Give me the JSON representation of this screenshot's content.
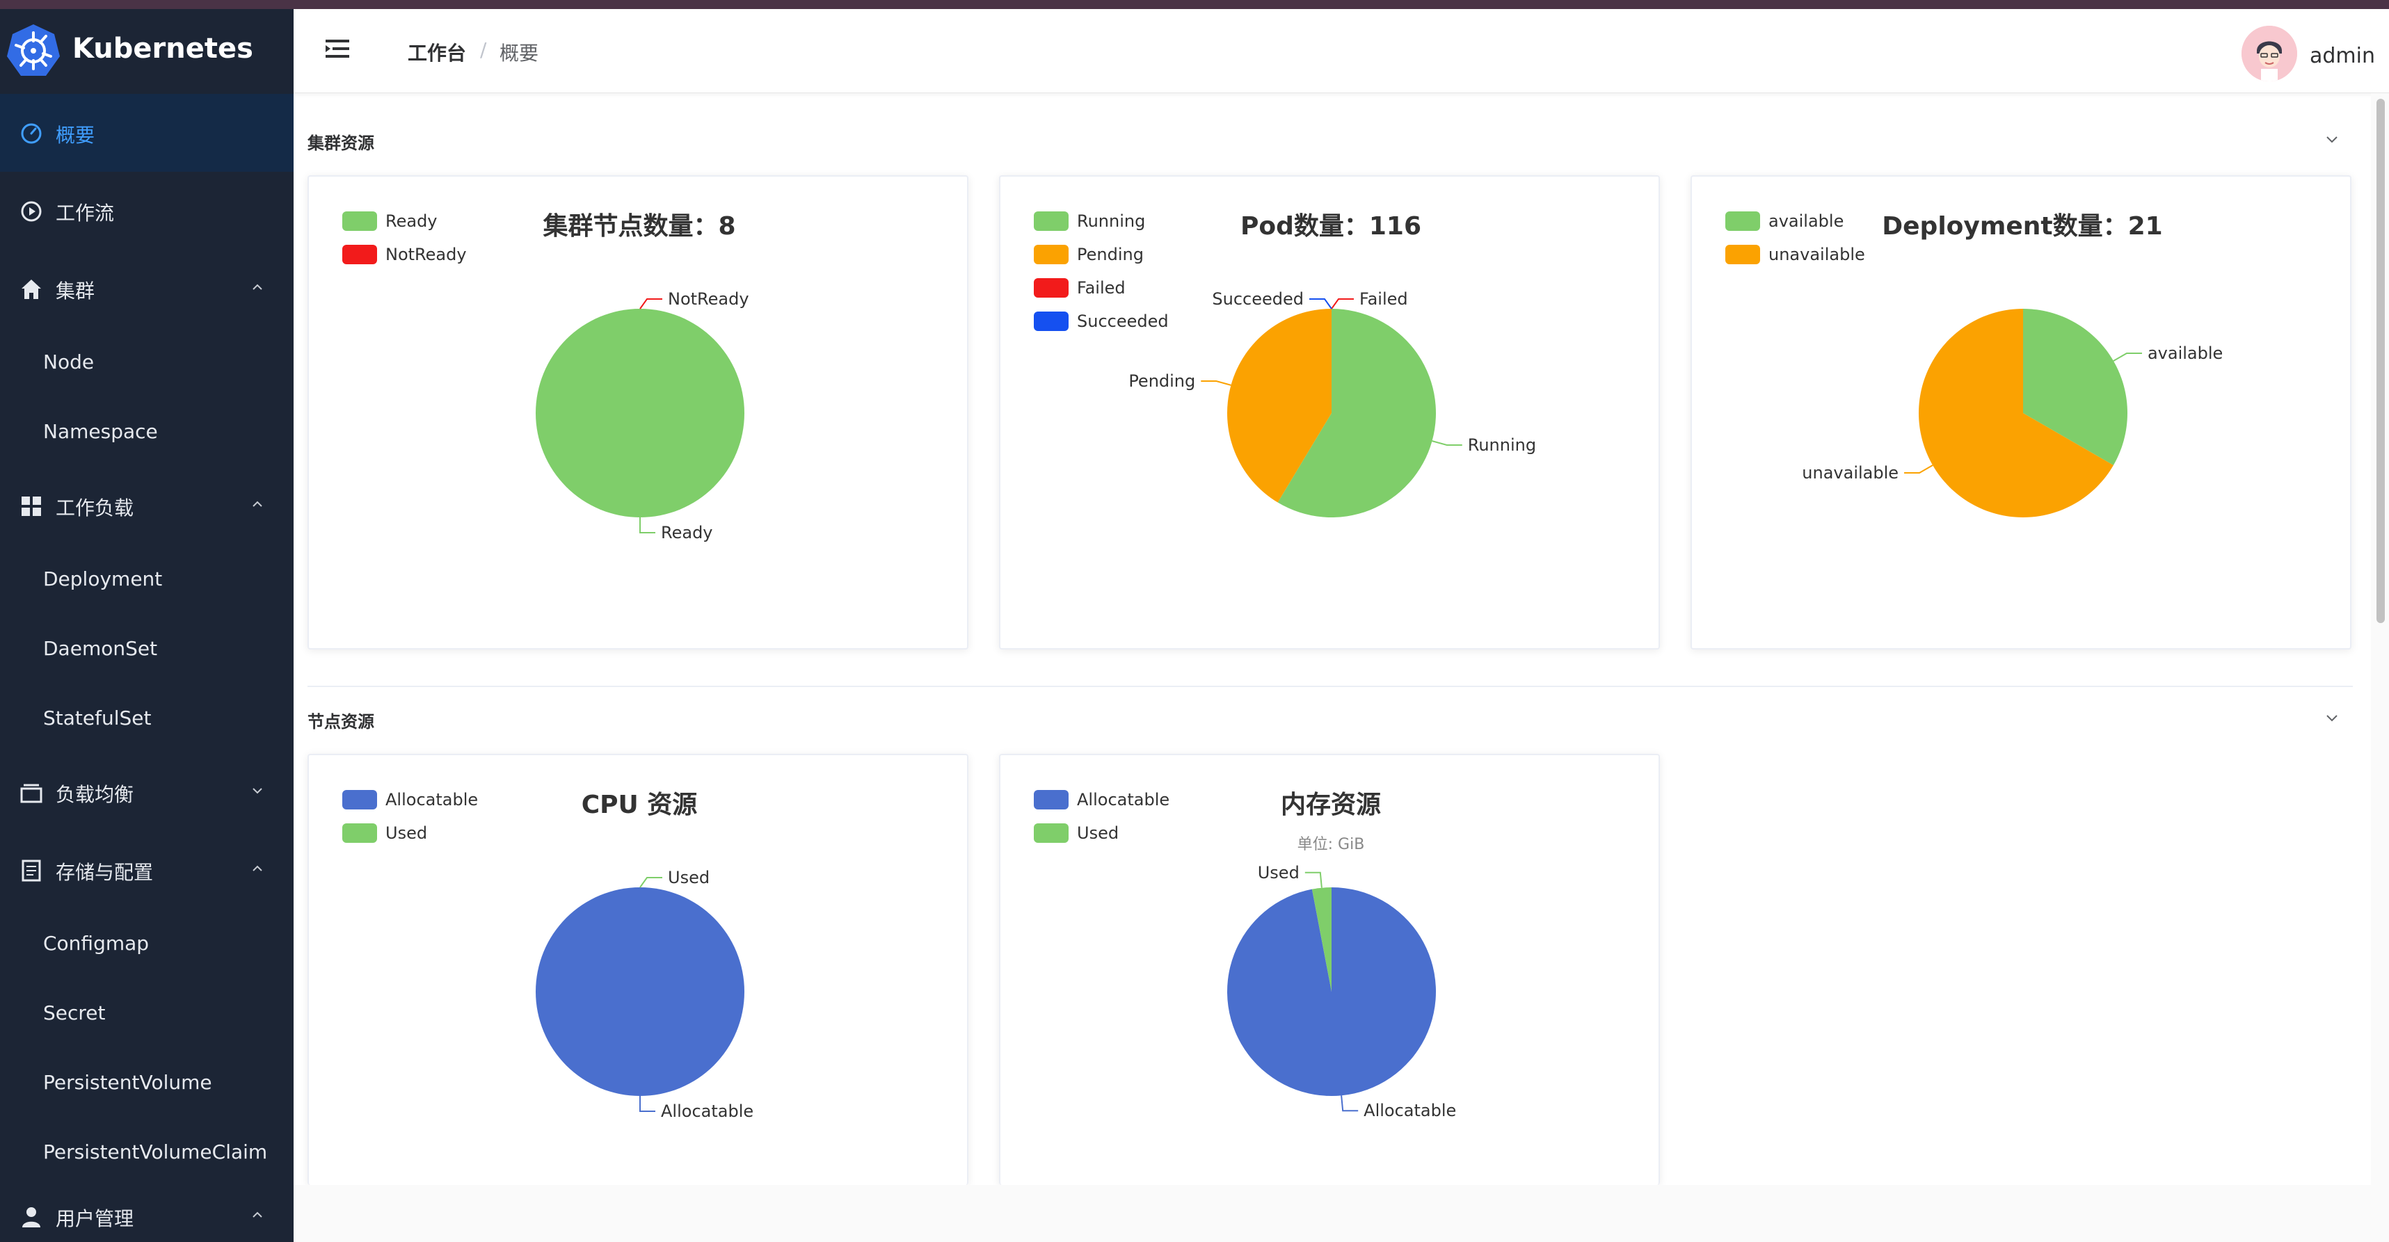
{
  "app": {
    "name": "Kubernetes"
  },
  "header": {
    "breadcrumb": [
      "工作台",
      "概要"
    ],
    "breadcrumb_separator": "/",
    "user": "admin"
  },
  "sidebar": {
    "items": [
      {
        "label": "概要",
        "icon": "dashboard-icon",
        "active": true
      },
      {
        "label": "工作流",
        "icon": "play-circle-icon"
      },
      {
        "label": "集群",
        "icon": "home-icon",
        "expanded": true,
        "children": [
          "Node",
          "Namespace"
        ]
      },
      {
        "label": "工作负载",
        "icon": "grid-icon",
        "expanded": true,
        "children": [
          "Deployment",
          "DaemonSet",
          "StatefulSet"
        ]
      },
      {
        "label": "负载均衡",
        "icon": "box-icon",
        "expanded": false
      },
      {
        "label": "存储与配置",
        "icon": "document-icon",
        "expanded": true,
        "children": [
          "Configmap",
          "Secret",
          "PersistentVolume",
          "PersistentVolumeClaim"
        ]
      },
      {
        "label": "用户管理",
        "icon": "user-icon",
        "expanded": true
      }
    ]
  },
  "sections": {
    "cluster": {
      "title": "集群资源"
    },
    "node": {
      "title": "节点资源"
    }
  },
  "colors": {
    "green": "#7fce6a",
    "orange": "#fba201",
    "red": "#f21b1b",
    "blue": "#1550f0",
    "steel_blue": "#4a6fce",
    "active_text": "#409eff"
  },
  "chart_data": [
    {
      "type": "pie",
      "title": "集群节点数量：8",
      "legend": [
        "Ready",
        "NotReady"
      ],
      "slices": [
        {
          "name": "Ready",
          "value": 8,
          "color": "#7fce6a"
        },
        {
          "name": "NotReady",
          "value": 0,
          "color": "#f21b1b"
        }
      ]
    },
    {
      "type": "pie",
      "title": "Pod数量：116",
      "legend": [
        "Running",
        "Pending",
        "Failed",
        "Succeeded"
      ],
      "slices": [
        {
          "name": "Running",
          "value": 68,
          "color": "#7fce6a"
        },
        {
          "name": "Pending",
          "value": 48,
          "color": "#fba201"
        },
        {
          "name": "Failed",
          "value": 0,
          "color": "#f21b1b"
        },
        {
          "name": "Succeeded",
          "value": 0,
          "color": "#1550f0"
        }
      ]
    },
    {
      "type": "pie",
      "title": "Deployment数量：21",
      "legend": [
        "available",
        "unavailable"
      ],
      "slices": [
        {
          "name": "available",
          "value": 7,
          "color": "#7fce6a"
        },
        {
          "name": "unavailable",
          "value": 14,
          "color": "#fba201"
        }
      ]
    },
    {
      "type": "pie",
      "title": "CPU 资源",
      "legend": [
        "Allocatable",
        "Used"
      ],
      "slices": [
        {
          "name": "Allocatable",
          "value": 100,
          "color": "#4a6fce"
        },
        {
          "name": "Used",
          "value": 0,
          "color": "#7fce6a"
        }
      ]
    },
    {
      "type": "pie",
      "title": "内存资源",
      "subtitle": "单位: GiB",
      "legend": [
        "Allocatable",
        "Used"
      ],
      "slices": [
        {
          "name": "Allocatable",
          "value": 97,
          "color": "#4a6fce"
        },
        {
          "name": "Used",
          "value": 3,
          "color": "#7fce6a"
        }
      ]
    }
  ]
}
